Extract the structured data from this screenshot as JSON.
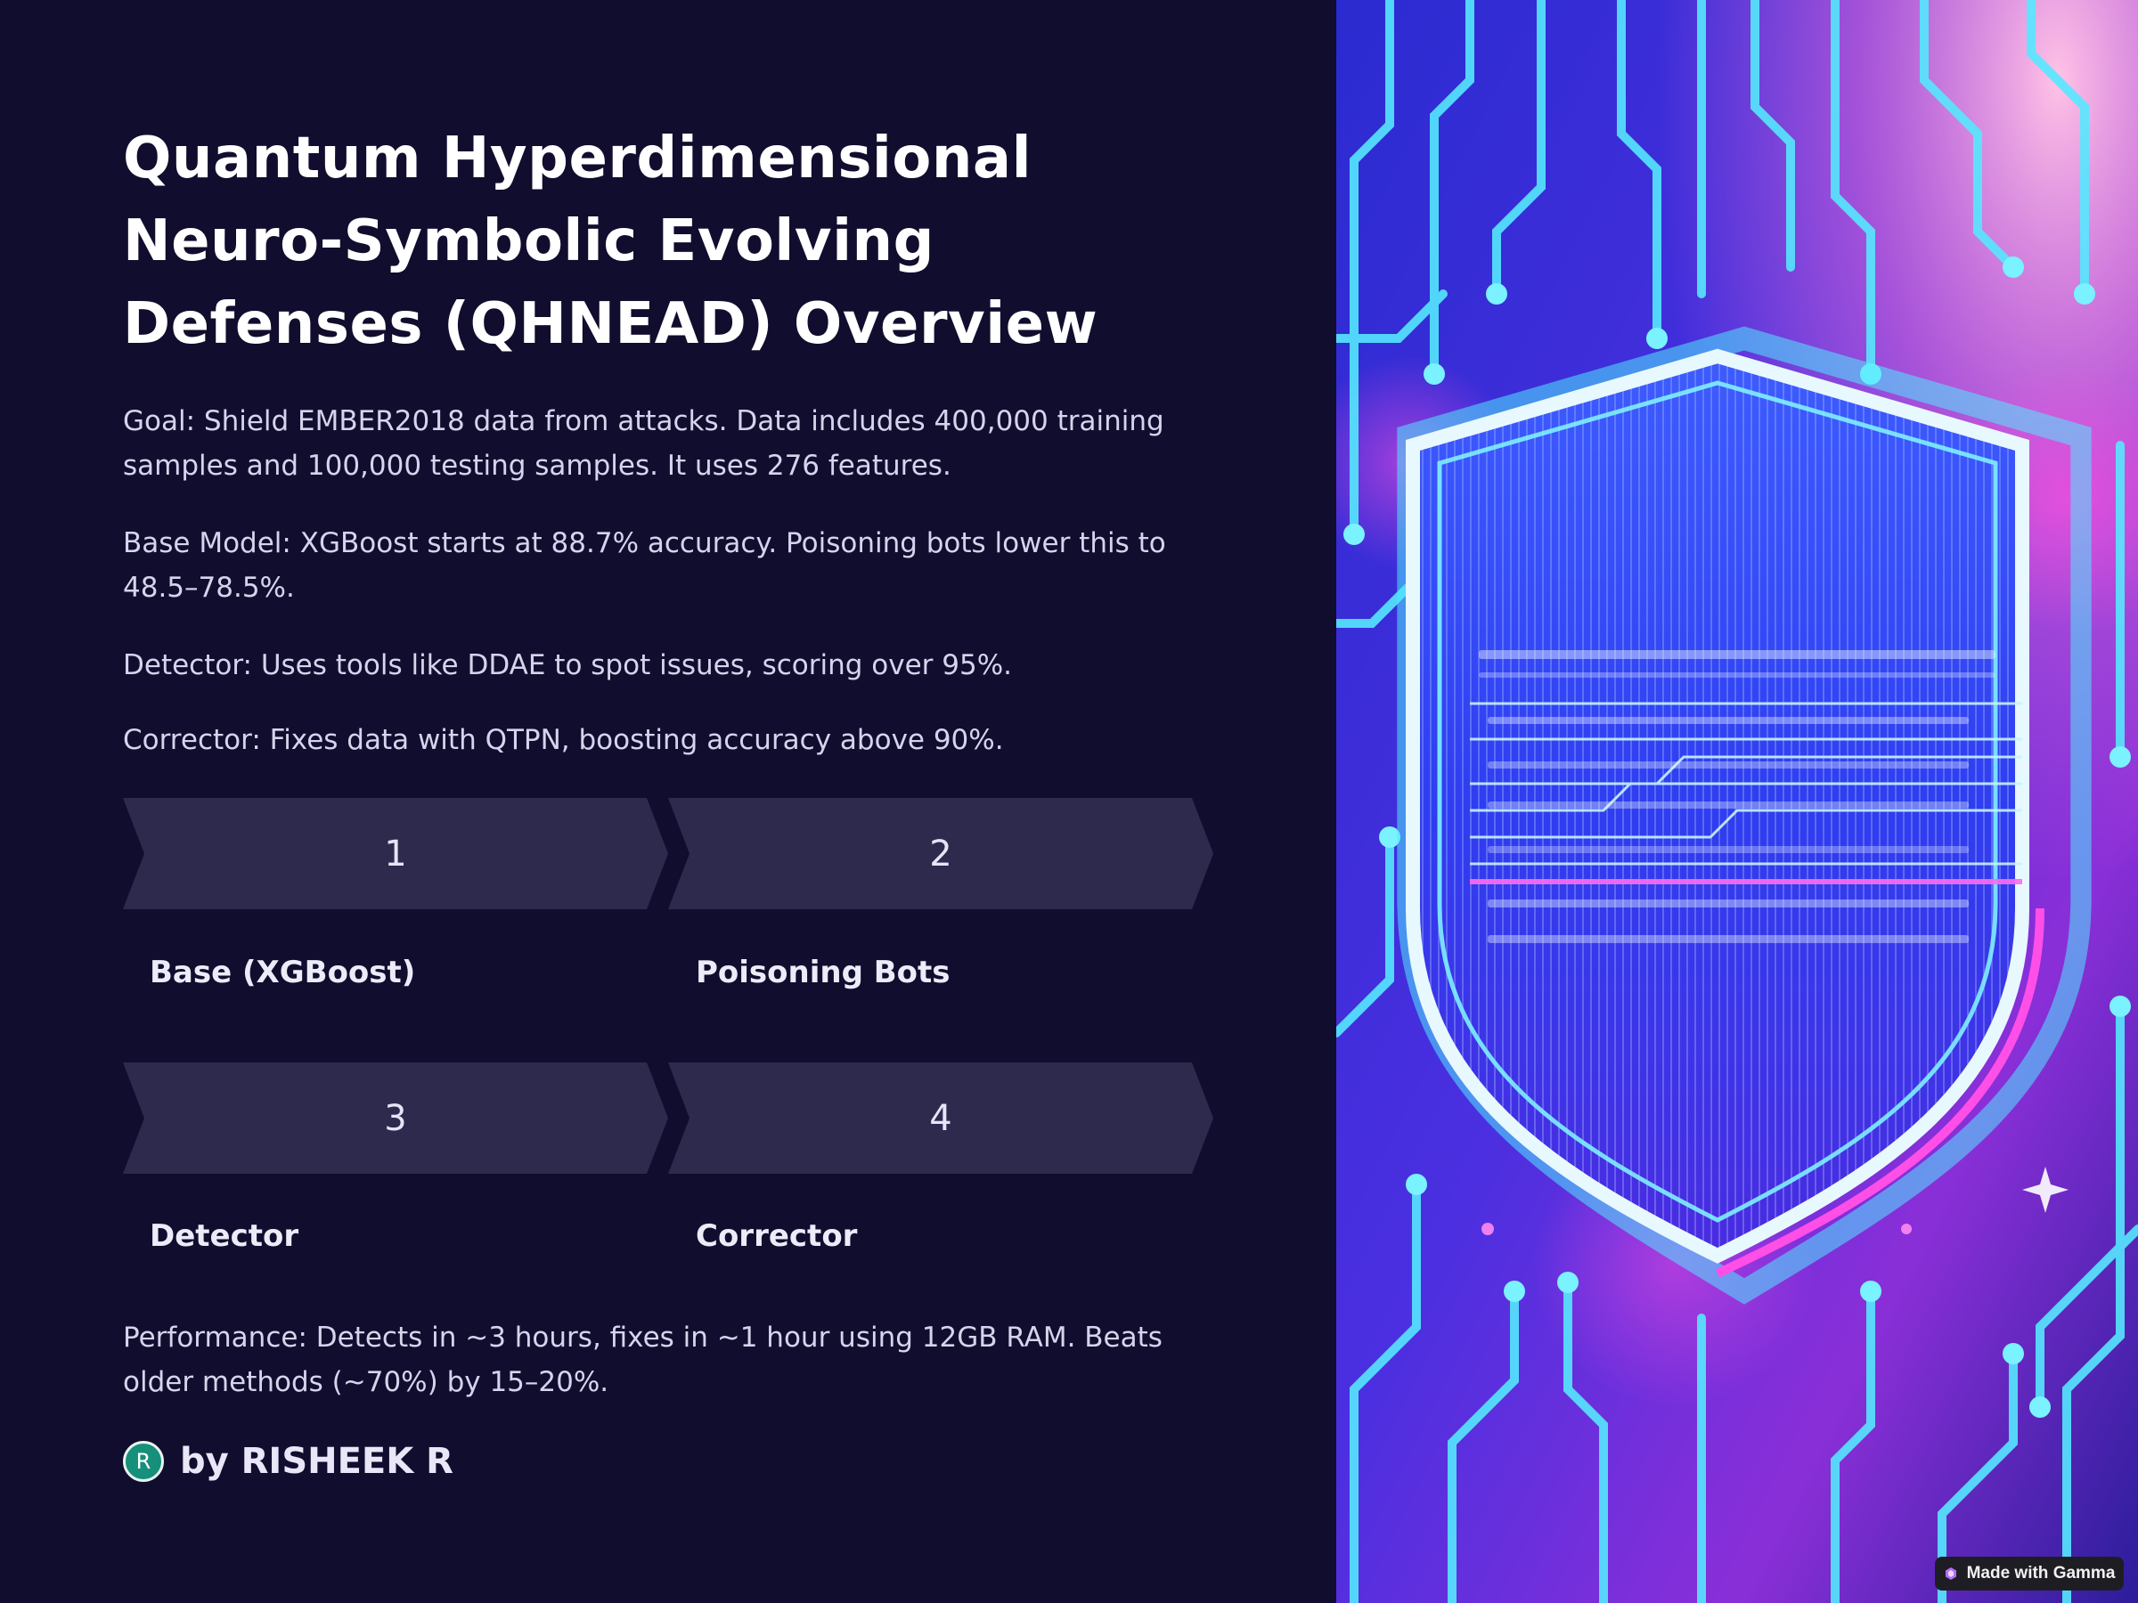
{
  "slide": {
    "title": "Quantum Hyperdimensional Neuro-Symbolic Evolving Defenses (QHNEAD) Overview",
    "paragraphs": [
      "Goal: Shield EMBER2018 data from attacks. Data includes 400,000 training samples and 100,000 testing samples. It uses 276 features.",
      "Base Model: XGBoost starts at 88.7% accuracy. Poisoning bots lower this to 48.5–78.5%.",
      "Detector: Uses tools like DDAE to spot issues, scoring over 95%.",
      "Corrector: Fixes data with QTPN, boosting accuracy above 90%."
    ],
    "steps": [
      {
        "number": "1",
        "label": "Base (XGBoost)"
      },
      {
        "number": "2",
        "label": "Poisoning Bots"
      },
      {
        "number": "3",
        "label": "Detector"
      },
      {
        "number": "4",
        "label": "Corrector"
      }
    ],
    "performance": "Performance: Detects in ~3 hours, fixes in ~1 hour using 12GB RAM. Beats older methods (~70%) by 15–20%.",
    "author": {
      "initial": "R",
      "name": "by RISHEEK R"
    },
    "image": {
      "icon": "shield-circuit-illustration-icon"
    }
  },
  "badge": {
    "label": "Made with Gamma",
    "icon": "gamma-logo-icon"
  },
  "colors": {
    "background": "#110d2e",
    "step_fill": "#2e2a4e",
    "avatar": "#16907a",
    "accent_cyan": "#35d6f2",
    "accent_magenta": "#e040f0"
  }
}
